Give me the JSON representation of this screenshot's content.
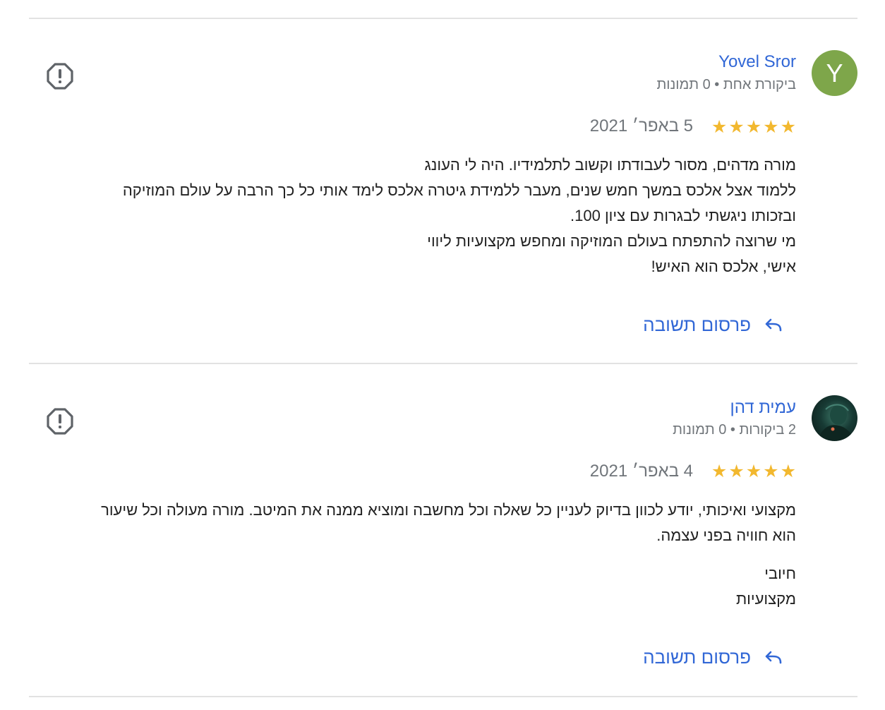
{
  "reviews": [
    {
      "avatar_letter": "Y",
      "avatar_color": "#7ea64a",
      "author": "Yovel Sror",
      "meta": "ביקורת אחת • 0 תמונות",
      "rating": 5,
      "stars": [
        "★",
        "★",
        "★",
        "★",
        "★"
      ],
      "date": "5 באפר׳ 2021",
      "text": "מורה מדהים, מסור לעבודתו וקשוב לתלמידיו. היה לי העונג\nללמוד אצל אלכס במשך חמש שנים, מעבר ללמידת גיטרה אלכס לימד אותי כל כך הרבה על עולם המוזיקה\nובזכותו ניגשתי לבגרות עם ציון 100.\nמי שרוצה להתפתח בעולם המוזיקה ומחפש מקצועיות ליווי\nאישי, אלכס הוא האיש!",
      "reply_label": "פרסום תשובה"
    },
    {
      "author": "עמית דהן",
      "meta": "2 ביקורות • 0 תמונות",
      "rating": 5,
      "stars": [
        "★",
        "★",
        "★",
        "★",
        "★"
      ],
      "date": "4 באפר׳ 2021",
      "text": "מקצועי ואיכותי, יודע לכוון בדיוק לעניין כל שאלה וכל מחשבה ומוציא ממנה את המיטב. מורה מעולה וכל שיעור\nהוא חוויה בפני עצמה.",
      "positives": "חיובי\nמקצועיות",
      "reply_label": "פרסום תשובה"
    }
  ],
  "colors": {
    "link": "#3167d6",
    "star": "#f2b82f",
    "meta": "#70757a",
    "divider": "#e2e2e2"
  },
  "icons": {
    "flag": "report-flag-icon",
    "reply": "reply-arrow-icon"
  }
}
